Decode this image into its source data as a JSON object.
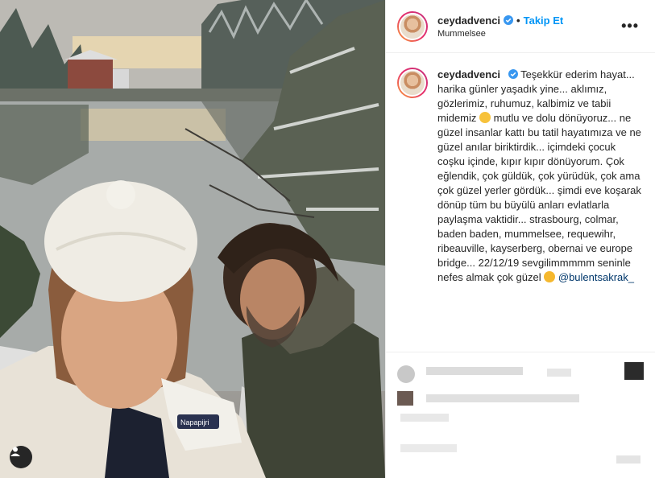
{
  "post": {
    "username": "ceydadvenci",
    "follow_label": "Takip Et",
    "separator": "•",
    "location": "Mummelsee",
    "more_label": "•••"
  },
  "caption": {
    "username": "ceydadvenci",
    "text_1": "Teşekkür ederim hayat... harika günler yaşadık yine... aklımız, gözlerimiz, ruhumuz, kalbimiz ve tabii midemiz",
    "text_2": "mutlu ve dolu dönüyoruz... ne güzel insanlar kattı bu tatil hayatımıza ve ne güzel anılar biriktirdik... içimdeki çocuk coşku içinde, kıpır kıpır dönüyorum. Çok eğlendik, çok güldük, çok yürüdük, çok ama çok güzel yerler gördük... şimdi eve koşarak dönüp tüm bu büyülü anları evlatlarla paylaşma vaktidir... strasbourg, colmar, baden baden, mummelsee, requewihr, ribeauville, kayserberg, obernai ve europe bridge... 22/12/19 sevgilimmmmm seninle nefes almak çok güzel",
    "mention": "@bulentsakrak_"
  },
  "photo": {
    "glove_label": "Napapijri"
  },
  "colors": {
    "follow": "#0095f6",
    "verified": "#3897f0",
    "mention": "#00376b"
  },
  "icons": [
    "verified-badge-icon",
    "more-options-icon",
    "user-icon",
    "laughing-emoji-icon",
    "heart-eyes-emoji-icon"
  ]
}
